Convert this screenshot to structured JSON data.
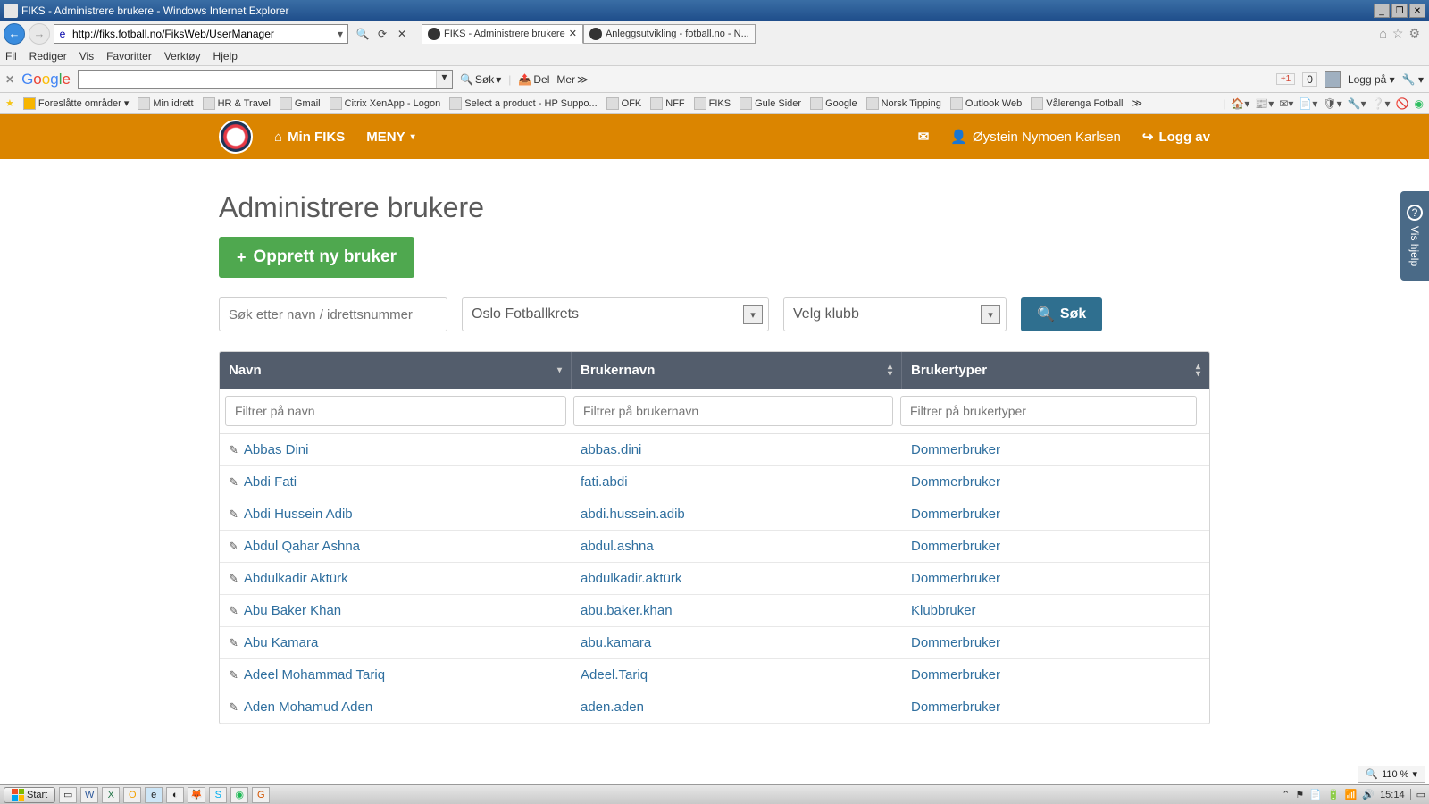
{
  "ie": {
    "title": "FIKS - Administrere brukere - Windows Internet Explorer",
    "url": "http://fiks.fotball.no/FiksWeb/UserManager",
    "tabs": [
      {
        "label": "FIKS - Administrere brukere",
        "active": true
      },
      {
        "label": "Anleggsutvikling - fotball.no - N...",
        "active": false
      }
    ],
    "menu": [
      "Fil",
      "Rediger",
      "Vis",
      "Favoritter",
      "Verktøy",
      "Hjelp"
    ],
    "gtb": {
      "search_btn": "Søk",
      "share_btn": "Del",
      "more_btn": "Mer",
      "plusone": "+1",
      "plusone_count": "0",
      "login_label": "Logg på"
    },
    "favbar_first": "Foreslåtte områder",
    "favlinks": [
      "Min idrett",
      "HR & Travel",
      "Gmail",
      "Citrix XenApp - Logon",
      "Select a product - HP Suppo...",
      "OFK",
      "NFF",
      "FIKS",
      "Gule Sider",
      "Google",
      "Norsk Tipping",
      "Outlook Web",
      "Vålerenga Fotball"
    ]
  },
  "header": {
    "min_fiks": "Min FIKS",
    "meny": "MENY",
    "username": "Øystein Nymoen Karlsen",
    "logout": "Logg av"
  },
  "page": {
    "title": "Administrere brukere",
    "new_user_btn": "Opprett ny bruker",
    "search_placeholder": "Søk etter navn / idrettsnummer",
    "select_krets": "Oslo Fotballkrets",
    "select_klubb": "Velg klubb",
    "search_btn": "Søk"
  },
  "table": {
    "cols": [
      "Navn",
      "Brukernavn",
      "Brukertyper"
    ],
    "filters": [
      "Filtrer på navn",
      "Filtrer på brukernavn",
      "Filtrer på brukertyper"
    ],
    "rows": [
      {
        "navn": "Abbas Dini",
        "brukernavn": "abbas.dini",
        "type": "Dommerbruker"
      },
      {
        "navn": "Abdi Fati",
        "brukernavn": "fati.abdi",
        "type": "Dommerbruker"
      },
      {
        "navn": "Abdi Hussein Adib",
        "brukernavn": "abdi.hussein.adib",
        "type": "Dommerbruker"
      },
      {
        "navn": "Abdul Qahar Ashna",
        "brukernavn": "abdul.ashna",
        "type": "Dommerbruker"
      },
      {
        "navn": "Abdulkadir Aktürk",
        "brukernavn": "abdulkadir.aktürk",
        "type": "Dommerbruker"
      },
      {
        "navn": "Abu Baker Khan",
        "brukernavn": "abu.baker.khan",
        "type": "Klubbruker"
      },
      {
        "navn": "Abu Kamara",
        "brukernavn": "abu.kamara",
        "type": "Dommerbruker"
      },
      {
        "navn": "Adeel Mohammad Tariq",
        "brukernavn": "Adeel.Tariq",
        "type": "Dommerbruker"
      },
      {
        "navn": "Aden Mohamud Aden",
        "brukernavn": "aden.aden",
        "type": "Dommerbruker"
      }
    ]
  },
  "help_tab": "Vis hjelp",
  "zoom": "110 %",
  "taskbar": {
    "start": "Start",
    "clock": "15:14"
  }
}
